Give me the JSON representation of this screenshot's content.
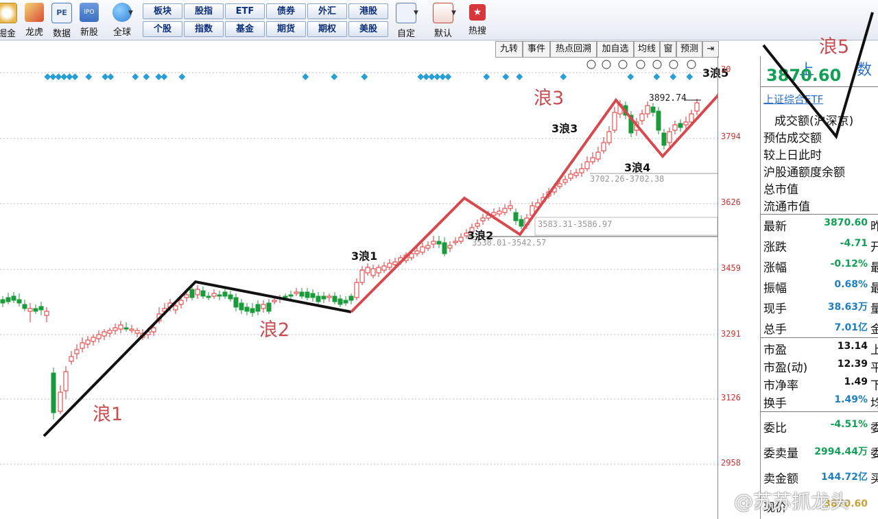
{
  "toolbar": {
    "icons": [
      {
        "label": "掘金",
        "icon": "gold-dig-icon",
        "color": "#e9b74a"
      },
      {
        "label": "龙虎",
        "icon": "dragon-tiger-icon",
        "color": "#d94a30"
      },
      {
        "label": "数据",
        "icon": "pe-data-icon",
        "color": "#4a78c2"
      },
      {
        "label": "新股",
        "icon": "ipo-icon",
        "color": "#3a6fc0"
      },
      {
        "label": "全球",
        "icon": "globe-icon",
        "color": "#2f7fd4"
      }
    ],
    "grid_buttons": [
      [
        "板块",
        "股指",
        "ETF",
        "债券",
        "外汇",
        "港股"
      ],
      [
        "个股",
        "指数",
        "基金",
        "期货",
        "期权",
        "美股"
      ]
    ],
    "right_icons": [
      {
        "label": "自定",
        "icon": "custom-edit-icon",
        "color": "#5c7fb5"
      },
      {
        "label": "默认",
        "icon": "home-icon",
        "color": "#c84a3a"
      },
      {
        "label": "热搜",
        "icon": "hot-search-icon",
        "color": "#d9363b"
      }
    ]
  },
  "tabs": [
    "九转",
    "事件",
    "热点回溯",
    "加自选",
    "均线",
    "窗",
    "预测"
  ],
  "yaxis": {
    "labels": [
      "3794",
      "3626",
      "3459",
      "3291",
      "3126",
      "2958"
    ],
    "top_partial": "30"
  },
  "annotations": {
    "high": "3892.74",
    "zone1": "3702.26-3702.38",
    "zone2": "3583.31-3586.97",
    "zone3": "3538.01-3542.57"
  },
  "waves": {
    "w1": "浪1",
    "w2": "浪2",
    "w3": "浪3",
    "w4": "浪4",
    "w5": "浪5"
  },
  "subwaves": {
    "s1": "3浪1",
    "s2": "3浪2",
    "s3": "3浪3",
    "s4": "3浪4",
    "s5": "3浪5"
  },
  "panel": {
    "title": "上",
    "title_right": "数",
    "price": "3870.60",
    "etf": "上证综合ETF",
    "rows_top": [
      "成交额(沪深京)",
      "预估成交额",
      "较上日此时",
      "沪股通额度余额",
      "总市值",
      "流通市值"
    ],
    "quotes": [
      {
        "label": "最新",
        "value": "3870.60",
        "tail": "昨"
      },
      {
        "label": "涨跌",
        "value": "-4.71",
        "tail": "开"
      },
      {
        "label": "涨幅",
        "value": "-0.12%",
        "tail": "最"
      },
      {
        "label": "振幅",
        "value": "0.68%",
        "tail": "最"
      },
      {
        "label": "现手",
        "value": "38.63万",
        "tail": "量"
      },
      {
        "label": "总手",
        "value": "7.01亿",
        "tail": "金"
      }
    ],
    "valuation": [
      {
        "label": "市盈",
        "value": "13.14",
        "tail": "上"
      },
      {
        "label": "市盈(动)",
        "value": "12.39",
        "tail": "平"
      },
      {
        "label": "市净率",
        "value": "1.49",
        "tail": "下"
      },
      {
        "label": "换手",
        "value": "1.49%",
        "tail": "均"
      }
    ],
    "orders": [
      {
        "label": "委比",
        "value": "-4.51%",
        "tail": "委"
      },
      {
        "label": "委卖量",
        "value": "2994.44万",
        "tail": "委"
      },
      {
        "label": "卖金额",
        "value": "144.72亿",
        "tail": "买"
      },
      {
        "label": "现价",
        "value": "3870.60",
        "tail": ""
      }
    ]
  },
  "watermark": "@苏苏抓龙头",
  "colors": {
    "up": "#e03030",
    "down": "#1a9a3a",
    "wave_up": "#d6494e",
    "wave_down": "#111111",
    "marker": "#2a9fd6"
  }
}
